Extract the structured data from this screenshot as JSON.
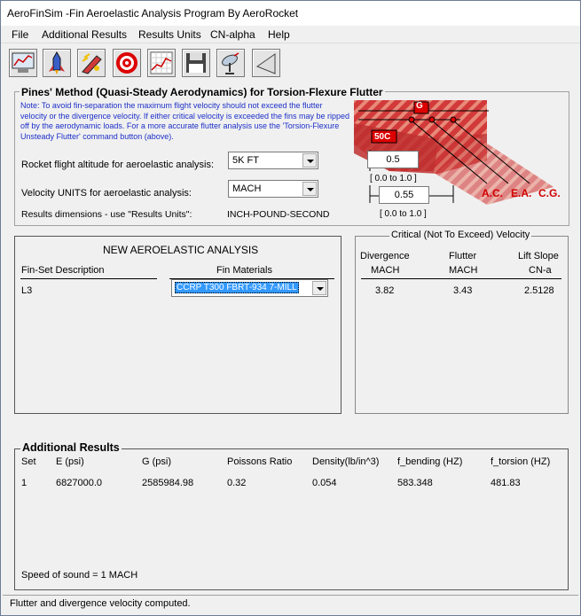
{
  "window": {
    "title": "AeroFinSim -Fin Aeroelastic Analysis Program By AeroRocket"
  },
  "menu": [
    "File",
    "Additional Results",
    "Results Units",
    "CN-alpha",
    "Help"
  ],
  "toolbar": [
    {
      "icon": "chart-screen-icon"
    },
    {
      "icon": "rocket-icon"
    },
    {
      "icon": "fin-flutter-icon"
    },
    {
      "icon": "target-icon"
    },
    {
      "icon": "graph-icon"
    },
    {
      "icon": "save-disk-icon"
    },
    {
      "icon": "satellite-dish-icon"
    },
    {
      "icon": "triangle-icon"
    }
  ],
  "pines": {
    "title": "Pines' Method (Quasi-Steady Aerodynamics) for Torsion-Flexure Flutter",
    "note": "Note: To avoid fin-separation the maximum flight velocity should not exceed the flutter velocity or the divergence velocity. If either critical velocity is exceeded the fins may be ripped off by the aerodynamic loads. For a more accurate flutter analysis use the 'Torsion-Flexure Unsteady Flutter' command button (above).",
    "altitude_label": "Rocket flight altitude for aeroelastic analysis:",
    "altitude_value": "5K FT",
    "velocity_label": "Velocity UNITS for aeroelastic analysis:",
    "velocity_value": "MACH",
    "dims_label": "Results dimensions - use \"Results Units\":",
    "dims_value": "INCH-POUND-SECOND",
    "diagram": {
      "field1": "0.5",
      "range1": "[ 0.0 to 1.0 ]",
      "field2": "0.55",
      "range2": "[ 0.0 to 1.0 ]",
      "ac": "A.C.",
      "ea": "E.A.",
      "cg": "C.G.",
      "tag_top": "G",
      "tag_side": "50C"
    }
  },
  "analysis": {
    "title": "NEW AEROELASTIC ANALYSIS",
    "col_fin": "Fin-Set Description",
    "col_mat": "Fin Materials",
    "fin": "L3",
    "material": "CCRP T300 FBRT-934 7-MILL"
  },
  "critical": {
    "title": "Critical (Not To Exceed) Velocity",
    "cols": [
      {
        "h1": "Divergence",
        "h2": "MACH",
        "v": "3.82"
      },
      {
        "h1": "Flutter",
        "h2": "MACH",
        "v": "3.43"
      },
      {
        "h1": "Lift Slope",
        "h2": "CN-a",
        "v": "2.5128"
      }
    ]
  },
  "additional": {
    "title": "Additional Results",
    "headers": [
      "Set",
      "E (psi)",
      "G (psi)",
      "Poissons Ratio",
      "Density(lb/in^3)",
      "f_bending (HZ)",
      "f_torsion (HZ)"
    ],
    "row": [
      "1",
      "6827000.0",
      "2585984.98",
      "0.32",
      "0.054",
      "583.348",
      "481.83"
    ],
    "sound": "Speed of sound = 1 MACH"
  },
  "status": "Flutter and divergence velocity computed.",
  "colors": {
    "note_blue": "#1c2fc8",
    "fin_red": "#d23a3a",
    "label_red": "#d00000",
    "selection": "#3399ff"
  }
}
